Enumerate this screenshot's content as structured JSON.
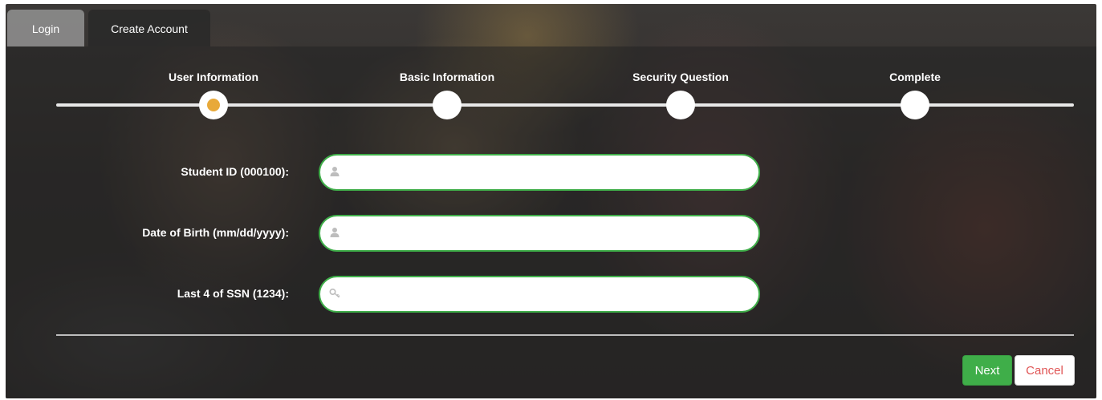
{
  "tabs": {
    "login": "Login",
    "create_account": "Create Account"
  },
  "steps": [
    {
      "label": "User Information",
      "active": true
    },
    {
      "label": "Basic Information",
      "active": false
    },
    {
      "label": "Security Question",
      "active": false
    },
    {
      "label": "Complete",
      "active": false
    }
  ],
  "form": {
    "student_id": {
      "label": "Student ID (000100):",
      "value": "",
      "icon": "user-icon"
    },
    "dob": {
      "label": "Date of Birth (mm/dd/yyyy):",
      "value": "",
      "icon": "user-icon"
    },
    "ssn": {
      "label": "Last 4 of SSN (1234):",
      "value": "",
      "icon": "key-icon"
    }
  },
  "buttons": {
    "next": "Next",
    "cancel": "Cancel"
  },
  "colors": {
    "accent_green": "#3fae49",
    "active_step": "#e8a93a",
    "cancel_text": "#e05555"
  }
}
